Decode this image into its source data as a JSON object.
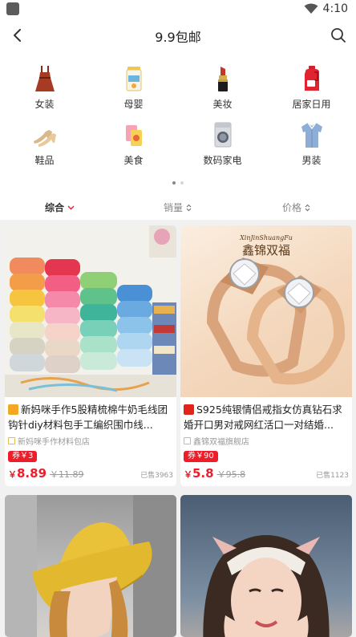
{
  "status_bar": {
    "time": "4:10"
  },
  "header": {
    "title": "9.9包邮"
  },
  "categories": [
    {
      "label": "女装",
      "icon": "dress-icon"
    },
    {
      "label": "母婴",
      "icon": "baby-formula-icon"
    },
    {
      "label": "美妆",
      "icon": "lipstick-icon"
    },
    {
      "label": "居家日用",
      "icon": "detergent-bottle-icon"
    },
    {
      "label": "鞋品",
      "icon": "high-heel-icon"
    },
    {
      "label": "美食",
      "icon": "snack-icon"
    },
    {
      "label": "数码家电",
      "icon": "washing-machine-icon"
    },
    {
      "label": "男装",
      "icon": "shirt-icon"
    }
  ],
  "sort": {
    "comprehensive": "综合",
    "sales": "销量",
    "price": "价格"
  },
  "products": [
    {
      "title": "新妈咪手作5股精梳棉牛奶毛线团钩针diy材料包手工编织围巾线...",
      "shop": "新妈咪手作材料包店",
      "coupon": "券￥3",
      "price_symbol": "￥",
      "price": "8.89",
      "original_price": "￥11.89",
      "sold": "已售3963",
      "platform_color": "#f5a623",
      "image_text": ""
    },
    {
      "title": "S925纯银情侣戒指女仿真钻石求婚开口男对戒网红活口一对结婚...",
      "shop": "鑫锦双福旗舰店",
      "coupon": "券￥90",
      "price_symbol": "￥",
      "price": "5.8",
      "original_price": "￥95.8",
      "sold": "已售1123",
      "platform_color": "#e0231b",
      "image_text": "XinJinShuangFu",
      "image_text_cn": "鑫锦双福"
    },
    {
      "title": "",
      "shop": "",
      "coupon": "",
      "price": "",
      "original_price": "",
      "sold": ""
    },
    {
      "title": "",
      "shop": "",
      "coupon": "",
      "price": "",
      "original_price": "",
      "sold": ""
    }
  ]
}
